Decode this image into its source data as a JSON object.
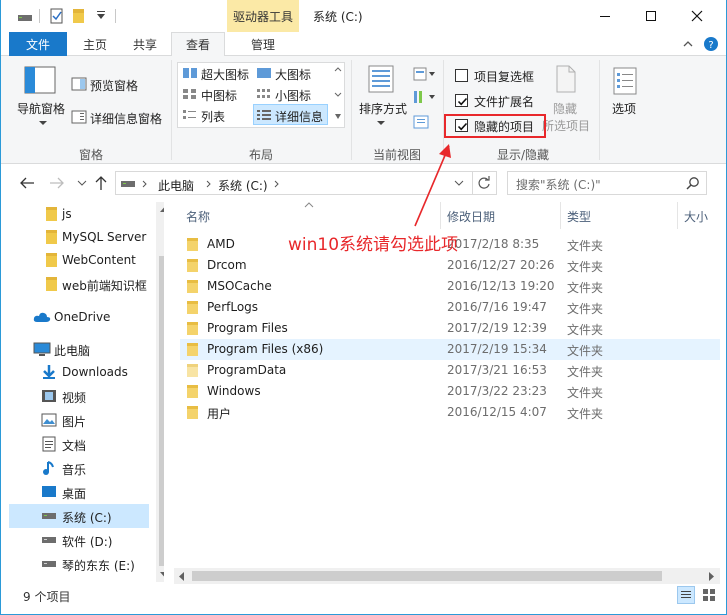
{
  "titlebar": {
    "context_tab": "驱动器工具",
    "title": "系统 (C:)"
  },
  "tabs": {
    "file": "文件",
    "home": "主页",
    "share": "共享",
    "view": "查看",
    "manage": "管理"
  },
  "ribbon": {
    "panes": {
      "nav_pane": "导航窗格",
      "preview_pane": "预览窗格",
      "details_pane": "详细信息窗格",
      "group": "窗格"
    },
    "layout": {
      "extra_large": "超大图标",
      "large": "大图标",
      "medium": "中图标",
      "small": "小图标",
      "list": "列表",
      "details": "详细信息",
      "group": "布局"
    },
    "current_view": {
      "sort_by": "排序方式",
      "group": "当前视图"
    },
    "show_hide": {
      "item_checkboxes": "项目复选框",
      "item_checkboxes_checked": false,
      "file_extensions": "文件扩展名",
      "file_extensions_checked": true,
      "hidden_items": "隐藏的项目",
      "hidden_items_checked": true,
      "hide_selected_1": "隐藏",
      "hide_selected_2": "所选项目",
      "group": "显示/隐藏"
    },
    "options": "选项"
  },
  "address": {
    "crumb_pc": "此电脑",
    "crumb_drive": "系统 (C:)",
    "search_placeholder": "搜索\"系统 (C:)\""
  },
  "nav": {
    "items": [
      {
        "label": "js",
        "icon": "folder-icon"
      },
      {
        "label": "MySQL Server",
        "icon": "folder-icon"
      },
      {
        "label": "WebContent",
        "icon": "folder-icon"
      },
      {
        "label": "web前端知识框",
        "icon": "folder-icon"
      },
      {
        "label": "OneDrive",
        "icon": "onedrive-icon"
      },
      {
        "label": "此电脑",
        "icon": "computer-icon"
      },
      {
        "label": "Downloads",
        "icon": "download-icon"
      },
      {
        "label": "视频",
        "icon": "video-icon"
      },
      {
        "label": "图片",
        "icon": "picture-icon"
      },
      {
        "label": "文档",
        "icon": "document-icon"
      },
      {
        "label": "音乐",
        "icon": "music-icon"
      },
      {
        "label": "桌面",
        "icon": "desktop-icon"
      },
      {
        "label": "系统 (C:)",
        "icon": "drive-icon"
      },
      {
        "label": "软件 (D:)",
        "icon": "drive-icon"
      },
      {
        "label": "琴的东东 (E:)",
        "icon": "drive-icon"
      }
    ]
  },
  "columns": {
    "name": "名称",
    "date": "修改日期",
    "type": "类型",
    "size": "大小"
  },
  "files": [
    {
      "name": "AMD",
      "date": "2017/2/18 8:35",
      "type": "文件夹"
    },
    {
      "name": "Drcom",
      "date": "2016/12/27 20:26",
      "type": "文件夹"
    },
    {
      "name": "MSOCache",
      "date": "2016/12/13 19:20",
      "type": "文件夹"
    },
    {
      "name": "PerfLogs",
      "date": "2016/7/16 19:47",
      "type": "文件夹"
    },
    {
      "name": "Program Files",
      "date": "2017/2/19 12:39",
      "type": "文件夹"
    },
    {
      "name": "Program Files (x86)",
      "date": "2017/2/19 15:34",
      "type": "文件夹"
    },
    {
      "name": "ProgramData",
      "date": "2017/3/21 16:53",
      "type": "文件夹"
    },
    {
      "name": "Windows",
      "date": "2017/3/22 23:23",
      "type": "文件夹"
    },
    {
      "name": "用户",
      "date": "2016/12/15 4:07",
      "type": "文件夹"
    }
  ],
  "status": {
    "count": "9 个项目"
  },
  "annotation": {
    "text": "win10系统请勾选此项",
    "color": "#e8282b"
  },
  "colors": {
    "accent": "#1979ca",
    "selection": "#cce8ff",
    "folder": "#f0c94a"
  }
}
